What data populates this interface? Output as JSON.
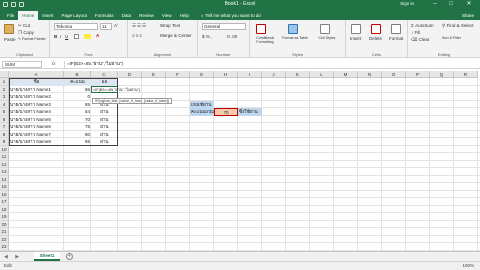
{
  "window": {
    "title": "Book1 - Excel",
    "sign_in": "Sign in",
    "min": "–",
    "max": "□",
    "close": "✕"
  },
  "tabs": [
    "File",
    "Home",
    "Insert",
    "Page Layout",
    "Formulas",
    "Data",
    "Review",
    "View",
    "Help"
  ],
  "active_tab": "Home",
  "tell_me": "Tell me what you want to do",
  "share": "Share",
  "ribbon": {
    "paste": "Paste",
    "cut": "Cut",
    "copy": "Copy",
    "format_painter": "Format Painter",
    "font_name": "Tahoma",
    "font_size": "11",
    "wrap_text": "Wrap Text",
    "merge_center": "Merge & Center",
    "number_format": "General",
    "conditional_formatting": "Conditional Formatting",
    "format_as_table": "Format as Table",
    "cell_styles": "Cell Styles",
    "insert": "Insert",
    "delete": "Delete",
    "format": "Format",
    "autosum": "AutoSum",
    "fill": "Fill",
    "clear": "Clear",
    "sort_filter": "Sort & Filter",
    "find_select": "Find & Select",
    "groups": [
      "Clipboard",
      "Font",
      "Alignment",
      "Number",
      "Styles",
      "Cells",
      "Editing"
    ]
  },
  "formula_bar": {
    "name_box": "SUM",
    "fx": "fx",
    "formula": "=IF(B3>=65,\"ผ่าน\",\"ไม่ผ่าน\")"
  },
  "columns": [
    "A",
    "B",
    "C",
    "D",
    "E",
    "F",
    "G",
    "H",
    "I",
    "J",
    "K",
    "L",
    "M",
    "N",
    "O",
    "P",
    "Q",
    "R"
  ],
  "rows": [
    "1",
    "2",
    "3",
    "4",
    "5",
    "6",
    "7",
    "8",
    "9",
    "10",
    "11",
    "12",
    "13",
    "14",
    "15",
    "16",
    "17",
    "18",
    "19",
    "20",
    "21",
    "22",
    "23"
  ],
  "table": {
    "header": [
      "ชื่อ",
      "คะแนน",
      "ผล"
    ],
    "records": [
      {
        "name": "นาย/นางสาว Name1",
        "score": "86",
        "result": "=IF(B3>=65,\"ผ่าน\",\"ไม่ผ่าน\")"
      },
      {
        "name": "นาย/นางสาว Name2",
        "score": "0",
        "result": ""
      },
      {
        "name": "นาย/นางสาว Name3",
        "score": "85",
        "result": "ผ่าน"
      },
      {
        "name": "นาย/นางสาว Name4",
        "score": "54",
        "result": "ผ่าน"
      },
      {
        "name": "นาย/นางสาว Name5",
        "score": "70",
        "result": "ผ่าน"
      },
      {
        "name": "นาย/นางสาว Name6",
        "score": "75",
        "result": "ผ่าน"
      },
      {
        "name": "นาย/นางสาว Name7",
        "score": "80",
        "result": "ผ่าน"
      },
      {
        "name": "นาย/นางสาว Name8",
        "score": "85",
        "result": "ผ่าน"
      }
    ]
  },
  "tooltip": "IF(logical_test, [value_if_true], [value_if_false])",
  "criteria": {
    "label_top": "เกณฑ์ผ่าน",
    "label": "คะแนนเกณฑ์",
    "value": "70",
    "note": "ซึ่งใช้ผ่าน"
  },
  "sheet": {
    "name": "Sheet1",
    "add": "+",
    "nav": "◀ ▶"
  },
  "status": {
    "mode": "Edit",
    "zoom": "100%"
  },
  "colors": {
    "excel_green": "#217346",
    "header_fill": "#dce6f1",
    "criteria_fill": "#bdd7ee",
    "input_fill": "#f8cbad"
  }
}
